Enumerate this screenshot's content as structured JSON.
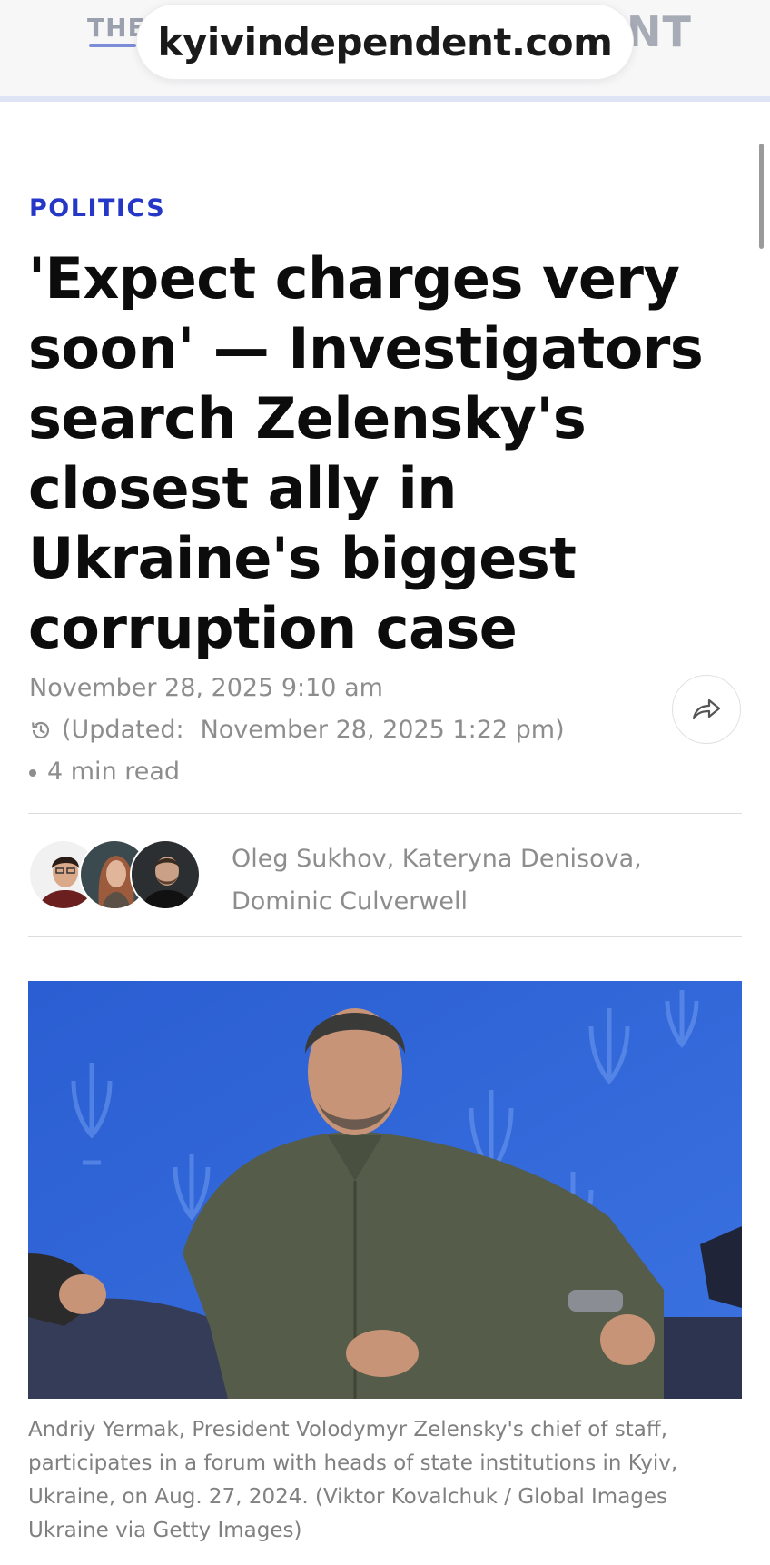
{
  "header": {
    "brand_left": "THE",
    "brand_right": "NT",
    "url": "kyivindependent.com"
  },
  "article": {
    "category": "POLITICS",
    "headline": "'Expect charges very soon' — Investigators search Zelensky's closest ally in Ukraine's biggest corruption case",
    "published": "November 28, 2025 9:10 am",
    "updated_prefix": "(Updated:",
    "updated_value": "November 28, 2025 1:22 pm)",
    "read_time": "4 min read",
    "authors_line1": "Oleg Sukhov, Kateryna Denisova,",
    "authors_line2": "Dominic Culverwell",
    "caption": "Andriy Yermak, President Volodymyr Zelensky's chief of staff, participates in a forum with heads of state institutions in Kyiv, Ukraine, on Aug. 27, 2024. (Viktor Kovalchuk / Global Images Ukraine via Getty Images)"
  },
  "icons": {
    "history": "history-clock-icon",
    "share": "share-arrow-icon"
  },
  "colors": {
    "category": "#2437c7",
    "meta": "#8d8d8d",
    "hero_background": "#2f64d6",
    "header_border": "#dfe3f6"
  }
}
